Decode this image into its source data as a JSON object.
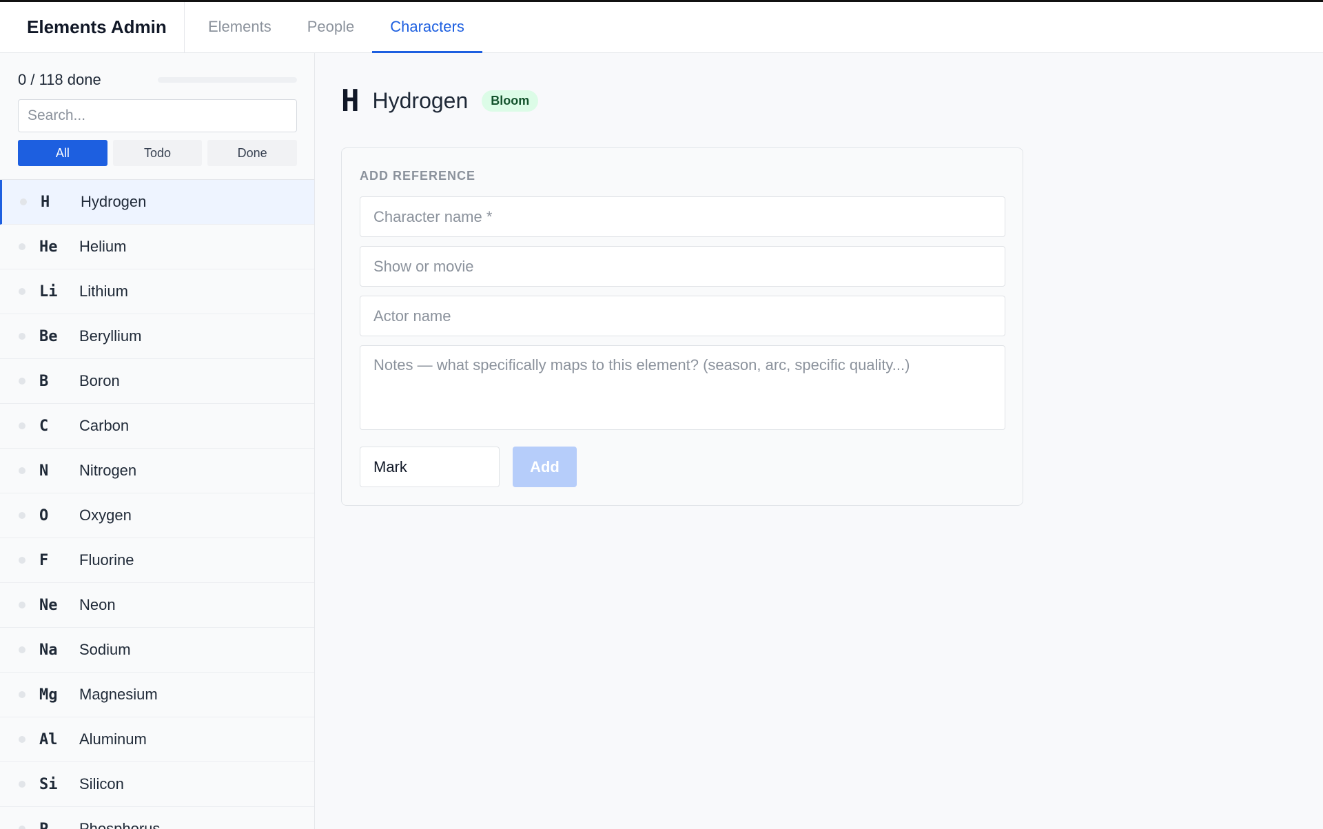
{
  "app": {
    "title": "Elements Admin"
  },
  "nav": {
    "tabs": [
      {
        "label": "Elements",
        "active": false
      },
      {
        "label": "People",
        "active": false
      },
      {
        "label": "Characters",
        "active": true
      }
    ]
  },
  "sidebar": {
    "progress_text": "0 / 118 done",
    "progress_value": 0,
    "search_placeholder": "Search...",
    "filters": [
      {
        "label": "All",
        "active": true
      },
      {
        "label": "Todo",
        "active": false
      },
      {
        "label": "Done",
        "active": false
      }
    ],
    "elements": [
      {
        "symbol": "H",
        "name": "Hydrogen",
        "selected": true
      },
      {
        "symbol": "He",
        "name": "Helium"
      },
      {
        "symbol": "Li",
        "name": "Lithium"
      },
      {
        "symbol": "Be",
        "name": "Beryllium"
      },
      {
        "symbol": "B",
        "name": "Boron"
      },
      {
        "symbol": "C",
        "name": "Carbon"
      },
      {
        "symbol": "N",
        "name": "Nitrogen"
      },
      {
        "symbol": "O",
        "name": "Oxygen"
      },
      {
        "symbol": "F",
        "name": "Fluorine"
      },
      {
        "symbol": "Ne",
        "name": "Neon"
      },
      {
        "symbol": "Na",
        "name": "Sodium"
      },
      {
        "symbol": "Mg",
        "name": "Magnesium"
      },
      {
        "symbol": "Al",
        "name": "Aluminum"
      },
      {
        "symbol": "Si",
        "name": "Silicon"
      },
      {
        "symbol": "P",
        "name": "Phosphorus"
      }
    ]
  },
  "main": {
    "symbol": "H",
    "name": "Hydrogen",
    "badge": "Bloom",
    "form": {
      "section_label": "ADD REFERENCE",
      "character_placeholder": "Character name *",
      "show_placeholder": "Show or movie",
      "actor_placeholder": "Actor name",
      "notes_placeholder": "Notes — what specifically maps to this element? (season, arc, specific quality...)",
      "person_value": "Mark",
      "add_label": "Add"
    }
  },
  "colors": {
    "accent": "#1d5fe0",
    "badge_bg": "#dcfce7",
    "add_disabled": "#b6cdfa"
  }
}
